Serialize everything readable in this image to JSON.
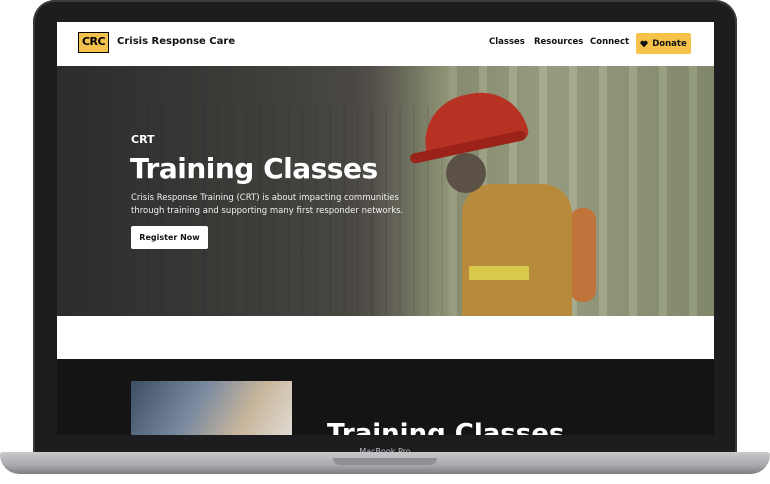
{
  "nav": {
    "logo_text": "CRC",
    "brand": "Crisis Response Care",
    "links": [
      "Classes",
      "Resources",
      "Connect"
    ],
    "donate_label": "Donate"
  },
  "hero": {
    "eyebrow": "CRT",
    "title": "Training Classes",
    "description": "Crisis Response Training (CRT) is about impacting communities through training and supporting many first responder networks.",
    "button_label": "Register Now"
  },
  "section": {
    "title": "Training Classes"
  },
  "device": {
    "label": "MacBook Pro"
  },
  "colors": {
    "accent": "#f6c34a",
    "dark": "#141414"
  }
}
